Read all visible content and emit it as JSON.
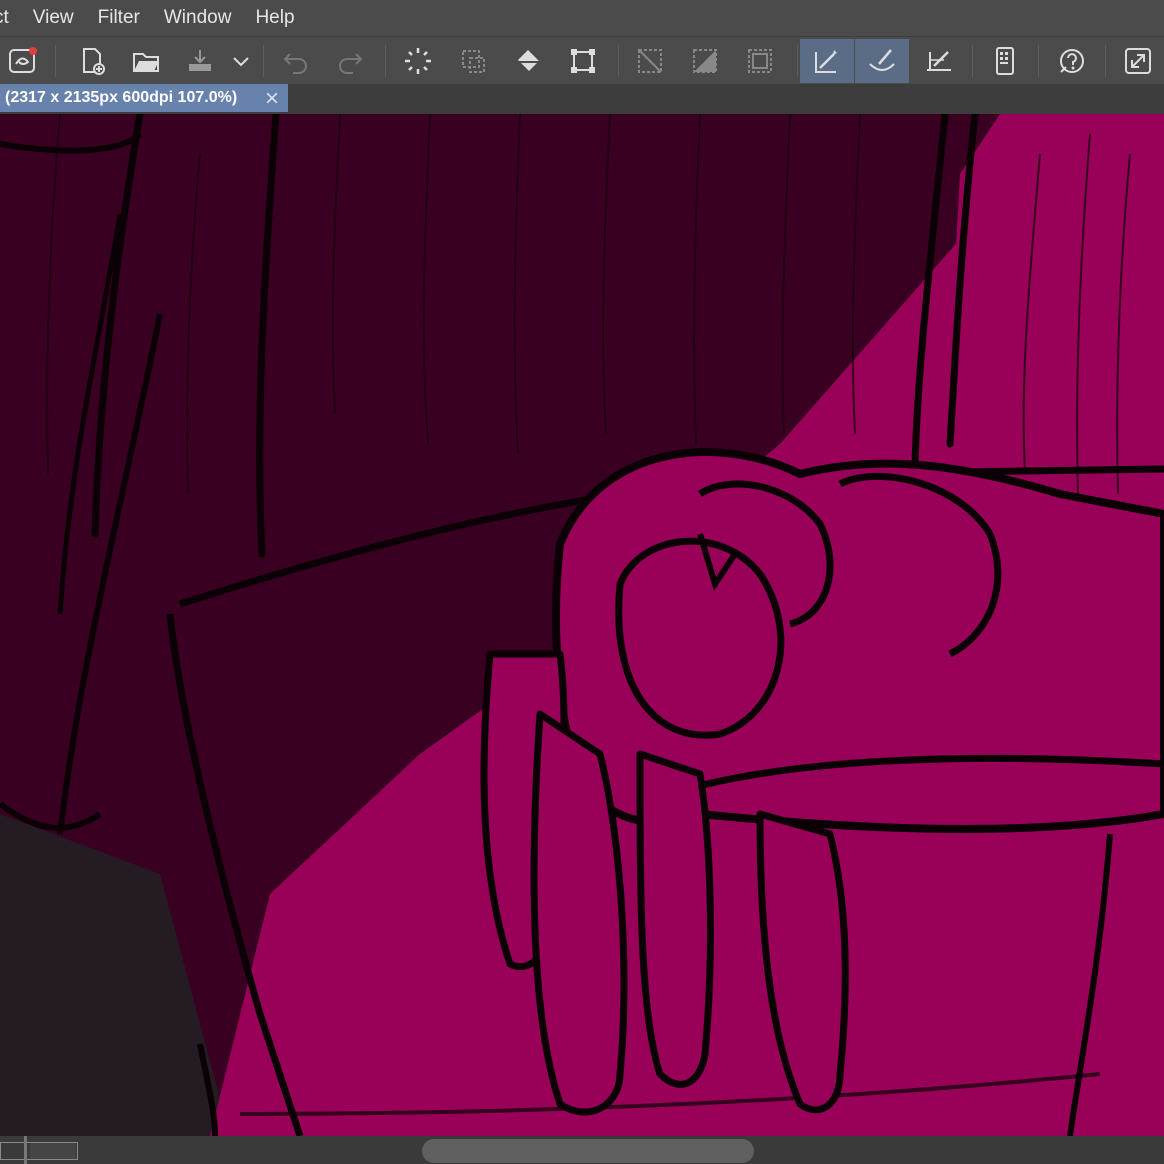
{
  "menu": {
    "items": [
      {
        "label": "ct"
      },
      {
        "label": "View"
      },
      {
        "label": "Filter"
      },
      {
        "label": "Window"
      },
      {
        "label": "Help"
      }
    ]
  },
  "toolbar": {
    "icons": [
      "brush-engine-icon",
      "new-document-icon",
      "open-folder-icon",
      "save-icon",
      "chevron-down-icon",
      "undo-icon",
      "redo-icon",
      "select-all-icon",
      "deselect-icon",
      "fill-icon",
      "transform-icon",
      "grid-off-icon",
      "gradient-icon",
      "pattern-icon",
      "brush-preset-icon",
      "smoothing-brush-icon",
      "pen-tool-icon",
      "layers-panel-icon",
      "help-icon",
      "fullscreen-icon"
    ],
    "active_color": "#5b6d86"
  },
  "document_tab": {
    "title": "(2317 x 2135px 600dpi 107.0%)",
    "color": "#6682ad"
  },
  "canvas": {
    "colors": {
      "dark": "#3a0022",
      "magenta": "#990058",
      "ink": "#0a0006",
      "grey": "#241c22"
    }
  }
}
